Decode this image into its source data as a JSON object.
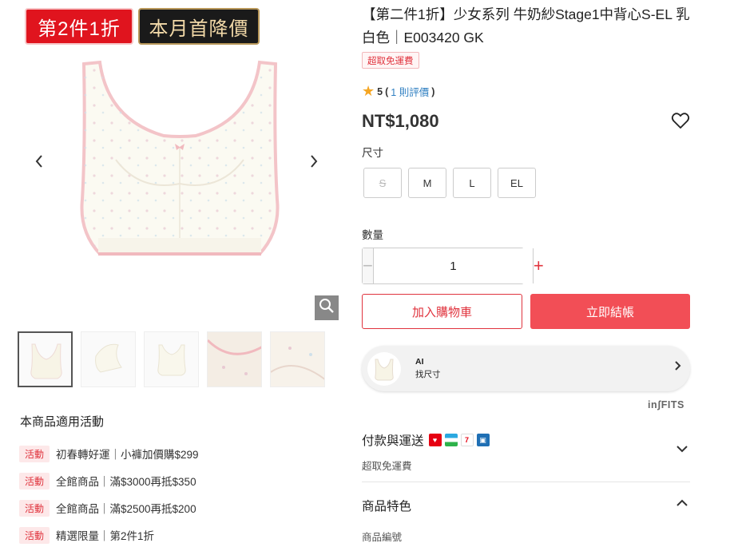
{
  "badges": {
    "discount": "第2件1折",
    "monthly": "本月首降價"
  },
  "gallery": {
    "prev_icon": "chevron-left-icon",
    "next_icon": "chevron-right-icon",
    "zoom_icon": "magnifier-icon",
    "thumbnail_count": 5,
    "active_thumbnail": 1
  },
  "promotions": {
    "title": "本商品適用活動",
    "items": [
      {
        "tag": "活動",
        "text": "初春轉好運｜小褲加價購$299"
      },
      {
        "tag": "活動",
        "text": "全館商品｜滿$3000再抵$350"
      },
      {
        "tag": "活動",
        "text": "全館商品｜滿$2500再抵$200"
      },
      {
        "tag": "活動",
        "text": "精選限量｜第2件1折"
      }
    ]
  },
  "product": {
    "title": "【第二件1折】少女系列 牛奶紗Stage1中背心S-EL 乳白色｜E003420 GK",
    "shipping_badge": "超取免運費",
    "rating": {
      "score": "5",
      "open": "(",
      "count_text": "1 則評價",
      "close": ")"
    },
    "price": "NT$1,080"
  },
  "size": {
    "label": "尺寸",
    "options": [
      {
        "label": "S",
        "available": false
      },
      {
        "label": "M",
        "available": true
      },
      {
        "label": "L",
        "available": true
      },
      {
        "label": "EL",
        "available": true
      }
    ]
  },
  "quantity": {
    "label": "數量",
    "value": "1",
    "minus": "−",
    "plus": "+"
  },
  "actions": {
    "add_to_cart": "加入購物車",
    "checkout": "立即結帳"
  },
  "ai_fit": {
    "title": "AI",
    "subtitle": "找尺寸",
    "brand": "inʃFITS"
  },
  "payment": {
    "title": "付款與運送",
    "subtitle": "超取免運費"
  },
  "features": {
    "title": "商品特色",
    "subtitle": "商品編號"
  },
  "colors": {
    "accent": "#e0343e",
    "checkout_bg": "#f24e56",
    "star": "#f5a623",
    "link": "#2f7fc1"
  }
}
